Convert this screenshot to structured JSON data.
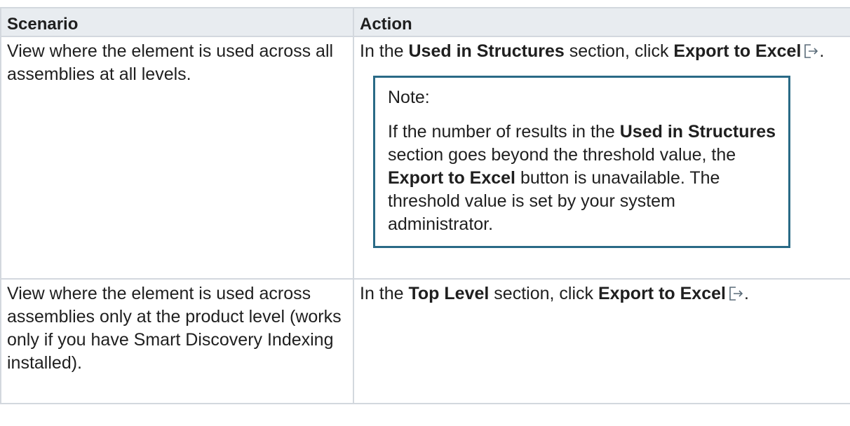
{
  "table": {
    "headers": {
      "scenario": "Scenario",
      "action": "Action"
    },
    "rows": [
      {
        "scenario": "View where the element is used across all assemblies at all levels.",
        "action": {
          "prefix": "In the ",
          "section": "Used in Structures",
          "middle": " section, click ",
          "button": "Export to Excel",
          "suffix": "."
        },
        "note": {
          "title": "Note:",
          "p1": "If the number of results in the ",
          "b1": "Used in Structures",
          "p2": " section goes beyond the threshold value, the ",
          "b2": "Export to Excel",
          "p3": " button is unavailable. The threshold value is set by your system administrator."
        }
      },
      {
        "scenario": "View where the element is used across assemblies only at the product level (works only if you have Smart Discovery Indexing installed).",
        "action": {
          "prefix": "In the ",
          "section": "Top Level",
          "middle": " section, click ",
          "button": "Export to Excel",
          "suffix": "."
        }
      }
    ]
  },
  "icons": {
    "export": "export-icon"
  },
  "colors": {
    "header_bg": "#e8ecf0",
    "border": "#d3d8de",
    "note_border": "#2a6a86",
    "icon": "#5a6b78"
  }
}
